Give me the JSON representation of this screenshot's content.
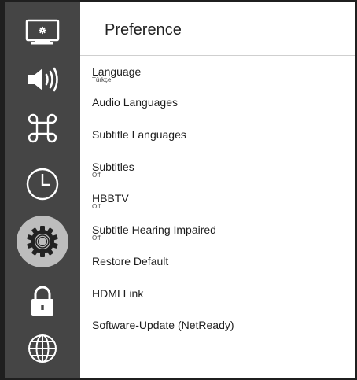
{
  "sidebar": {
    "items": [
      {
        "icon": "picture-settings-icon"
      },
      {
        "icon": "sound-icon"
      },
      {
        "icon": "command-icon"
      },
      {
        "icon": "clock-icon"
      },
      {
        "icon": "gear-icon",
        "selected": true
      },
      {
        "icon": "lock-icon"
      },
      {
        "icon": "globe-icon"
      }
    ]
  },
  "header": {
    "title": "Preference"
  },
  "menu": {
    "items": [
      {
        "label": "Language",
        "value": "Türkçe"
      },
      {
        "label": "Audio Languages"
      },
      {
        "label": "Subtitle Languages"
      },
      {
        "label": "Subtitles",
        "value": "Off"
      },
      {
        "label": "HBBTV",
        "value": "Off"
      },
      {
        "label": "Subtitle Hearing Impaired",
        "value": "Off"
      },
      {
        "label": "Restore Default"
      },
      {
        "label": "HDMI Link"
      },
      {
        "label": "Software-Update (NetReady)"
      }
    ]
  },
  "colors": {
    "sidebar_bg": "#454545",
    "selected_disc": "#bdbdbd",
    "icon": "#ffffff",
    "text": "#1d1d1d"
  }
}
